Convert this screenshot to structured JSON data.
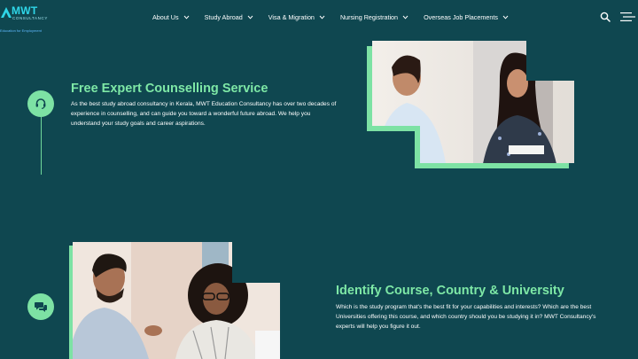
{
  "brand": {
    "name": "MWT",
    "sub": "CONSULTANCY",
    "tagline": "Education for Employment",
    "accent": "#2fd6e8"
  },
  "nav": {
    "items": [
      {
        "label": "About Us"
      },
      {
        "label": "Study Abroad"
      },
      {
        "label": "Visa & Migration"
      },
      {
        "label": "Nursing Registration"
      },
      {
        "label": "Overseas Job Placements"
      }
    ],
    "search_icon": "search-icon",
    "menu_icon": "hamburger-menu-icon"
  },
  "sections": [
    {
      "icon": "headset-icon",
      "title": "Free Expert Counselling Service",
      "body": "As the best study abroad consultancy in Kerala, MWT Education Consultancy has over two decades of experience in counselling, and can guide you toward a wonderful future abroad. We help you understand your study goals and career aspirations."
    },
    {
      "icon": "chat-bubbles-icon",
      "title": "Identify Course, Country & University",
      "body": "Which is the study program that's the best fit for your capabilities and interests? Which are the best Universities offering this course, and which country should you be studying it in? MWT Consultancy's experts will help you figure it out."
    }
  ],
  "colors": {
    "background": "#0f4750",
    "accent_green": "#7de2a4",
    "title_green": "#7ee8a6"
  }
}
